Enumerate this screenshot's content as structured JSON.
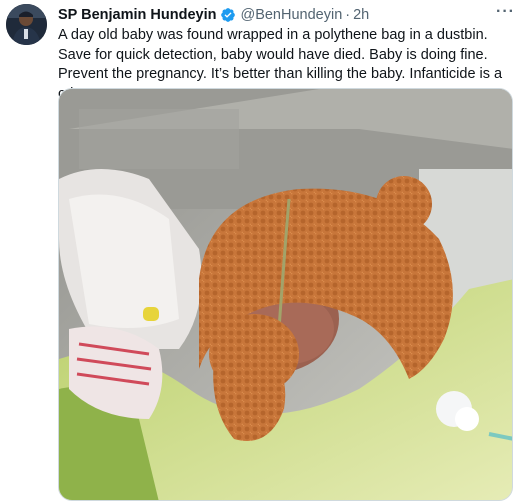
{
  "tweet": {
    "author_name": "SP Benjamin Hundeyin",
    "handle": "@BenHundeyin",
    "separator": "·",
    "time": "2h",
    "text": "A day old baby was found wrapped in a polythene bag in a dustbin. Save for quick detection, baby would have died. Baby is doing fine. Prevent the pregnancy. It’s better than killing the baby. Infanticide is a crime!",
    "verified": true
  },
  "icons": {
    "verified": "verified-badge-icon",
    "more": "more-options-icon"
  },
  "colors": {
    "verified_blue": "#1d9bf0",
    "secondary_text": "#536471",
    "primary_text": "#0f1419"
  }
}
